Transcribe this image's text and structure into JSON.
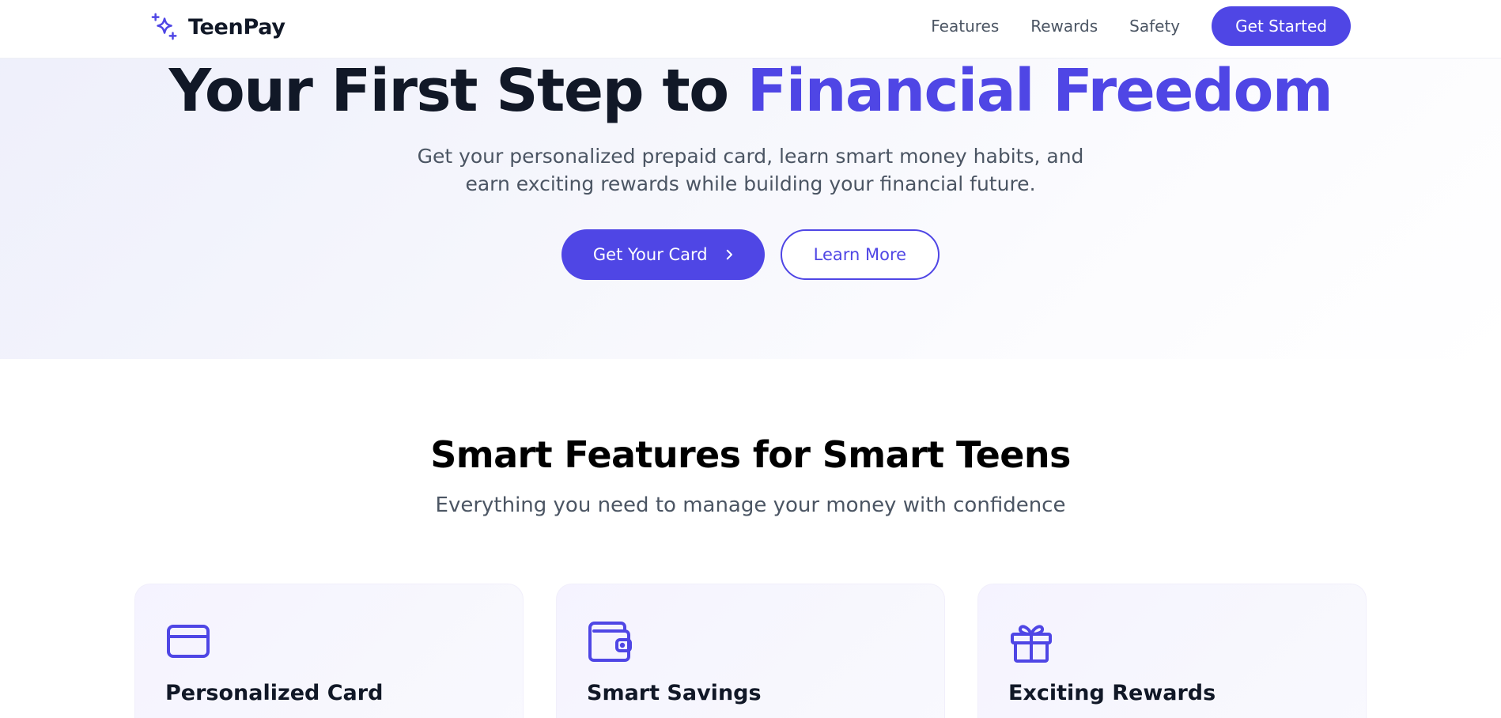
{
  "nav": {
    "brand": "TeenPay",
    "brand_icon": "sparkles-icon",
    "links": [
      "Features",
      "Rewards",
      "Safety"
    ],
    "cta": "Get Started"
  },
  "hero": {
    "title_main": "Your First Step to ",
    "title_accent": "Financial Freedom",
    "subtitle": "Get your personalized prepaid card, learn smart money habits, and earn exciting rewards while building your financial future.",
    "primary_button": "Get Your Card",
    "secondary_button": "Learn More"
  },
  "features": {
    "title": "Smart Features for Smart Teens",
    "subtitle": "Everything you need to manage your money with confidence",
    "cards": [
      {
        "title": "Personalized Card",
        "icon": "credit-card-icon"
      },
      {
        "title": "Smart Savings",
        "icon": "wallet-icon"
      },
      {
        "title": "Exciting Rewards",
        "icon": "gift-icon"
      }
    ]
  },
  "colors": {
    "accent": "#4f46e5",
    "text_dark": "#111827",
    "text_muted": "#4b5563"
  }
}
